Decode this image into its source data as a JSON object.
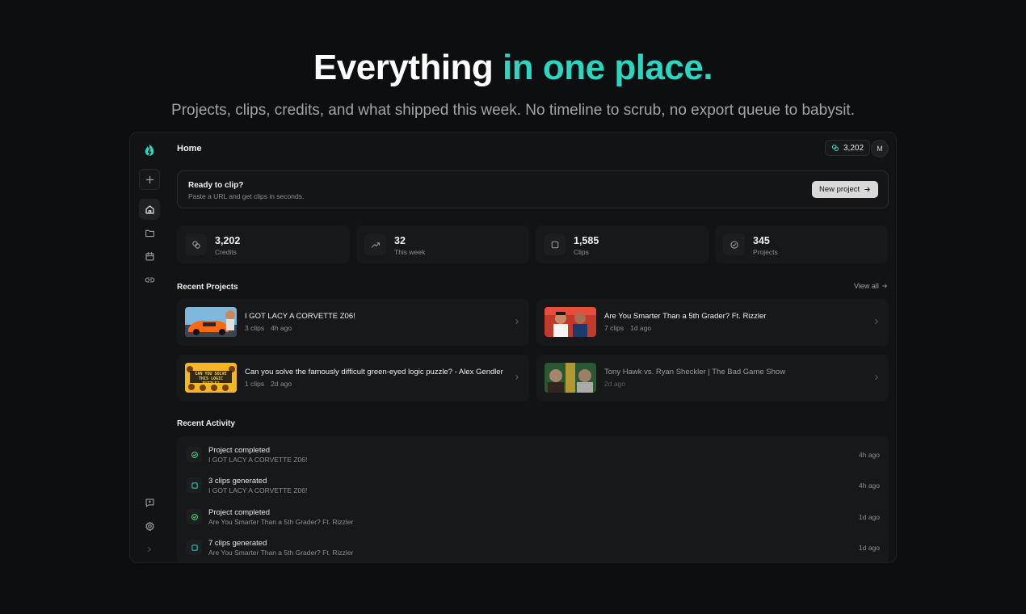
{
  "hero": {
    "title_main": "Everything",
    "title_accent": "in one place.",
    "subtitle": "Projects, clips, credits, and what shipped this week. No timeline to scrub, no export queue to babysit."
  },
  "colors": {
    "accent": "#2dd4bf",
    "background": "#0d0e0f",
    "panel": "#121314",
    "card": "#17181a"
  },
  "sidebar": {
    "icons": [
      "logo-icon",
      "plus-icon",
      "home-icon",
      "folder-icon",
      "calendar-icon",
      "link-icon",
      "feedback-icon",
      "gear-icon",
      "chevron-right-icon"
    ],
    "active": "home"
  },
  "header": {
    "title": "Home",
    "credits": "3,202",
    "avatar_initial": "M"
  },
  "banner": {
    "title": "Ready to clip?",
    "subtitle": "Paste a URL and get clips in seconds.",
    "button_label": "New project"
  },
  "stats": [
    {
      "value": "3,202",
      "label": "Credits",
      "icon": "credits-icon"
    },
    {
      "value": "32",
      "label": "This week",
      "icon": "trending-up-icon"
    },
    {
      "value": "1,585",
      "label": "Clips",
      "icon": "square-icon"
    },
    {
      "value": "345",
      "label": "Projects",
      "icon": "check-circle-icon"
    }
  ],
  "recent_projects": {
    "title": "Recent Projects",
    "view_all": "View all",
    "items": [
      {
        "title": "I GOT LACY A CORVETTE Z06!",
        "clips": "3 clips",
        "time": "4h ago",
        "thumb_text": ""
      },
      {
        "title": "Are You Smarter Than a 5th Grader? Ft. Rizzler",
        "clips": "7 clips",
        "time": "1d ago",
        "thumb_text": ""
      },
      {
        "title": "Can you solve the famously difficult green-eyed logic puzzle? - Alex Gendler",
        "clips": "1 clips",
        "time": "2d ago",
        "thumb_text": "CAN YOU SOLVE THIS LOGIC PUZZLE?"
      },
      {
        "title": "Tony Hawk vs. Ryan Sheckler | The Bad Game Show",
        "clips": "",
        "time": "2d ago",
        "thumb_text": ""
      }
    ]
  },
  "recent_activity": {
    "title": "Recent Activity",
    "items": [
      {
        "title": "Project completed",
        "subtitle": "I GOT LACY A CORVETTE Z06!",
        "time": "4h ago",
        "kind": "completed"
      },
      {
        "title": "3 clips generated",
        "subtitle": "I GOT LACY A CORVETTE Z06!",
        "time": "4h ago",
        "kind": "clips"
      },
      {
        "title": "Project completed",
        "subtitle": "Are You Smarter Than a 5th Grader? Ft. Rizzler",
        "time": "1d ago",
        "kind": "completed"
      },
      {
        "title": "7 clips generated",
        "subtitle": "Are You Smarter Than a 5th Grader? Ft. Rizzler",
        "time": "1d ago",
        "kind": "clips"
      }
    ]
  }
}
